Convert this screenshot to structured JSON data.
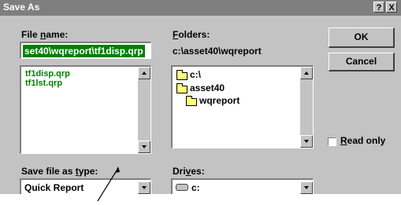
{
  "title": "Save As",
  "titlebar_buttons": {
    "help": "?",
    "close": "X"
  },
  "file_name": {
    "label_pre": "File ",
    "label_u": "n",
    "label_post": "ame:",
    "value": "set40\\wqreport\\tf1disp.qrp",
    "files": [
      "tf1disp.qrp",
      "tf1lst.qrp"
    ]
  },
  "folders": {
    "label_u": "F",
    "label_post": "olders:",
    "current_path": "c:\\asset40\\wqreport",
    "items": [
      "c:\\",
      "asset40",
      "wqreport"
    ]
  },
  "buttons": {
    "ok": "OK",
    "cancel": "Cancel"
  },
  "read_only": {
    "label_u": "R",
    "label_post": "ead only",
    "checked": false
  },
  "save_type": {
    "label_pre": "Save file as ",
    "label_u": "t",
    "label_post": "ype:",
    "value": "Quick Report"
  },
  "drives": {
    "label_pre": "Dri",
    "label_u": "v",
    "label_post": "es:",
    "value": "c:"
  },
  "colors": {
    "titlebar": "#7f7f7f",
    "dialog": "#c3c3c3",
    "selection": "#008000",
    "list_text": "#008000"
  }
}
